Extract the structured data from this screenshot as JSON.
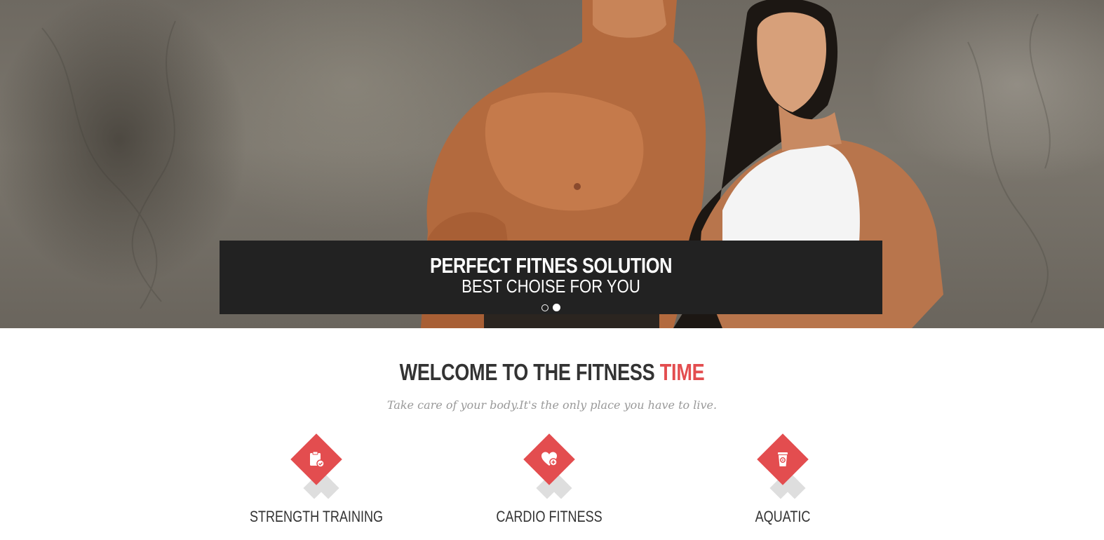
{
  "hero": {
    "title": "PERFECT FITNES SOLUTION",
    "subtitle": "BEST CHOISE FOR YOU",
    "slider": {
      "slides": 2,
      "active_index": 1
    }
  },
  "welcome": {
    "title_main": "WELCOME TO THE FITNESS ",
    "title_accent": "TIME",
    "subtitle": "Take care of your body.It's the only place you have to live."
  },
  "features": [
    {
      "label": "STRENGTH TRAINING",
      "icon": "clipboard-check-icon"
    },
    {
      "label": "CARDIO FITNESS",
      "icon": "heart-plus-icon"
    },
    {
      "label": "AQUATIC",
      "icon": "cup-icon"
    }
  ],
  "colors": {
    "accent": "#e34d4f",
    "caption_bg": "#222222",
    "text_dark": "#333333",
    "text_muted": "#999999"
  }
}
